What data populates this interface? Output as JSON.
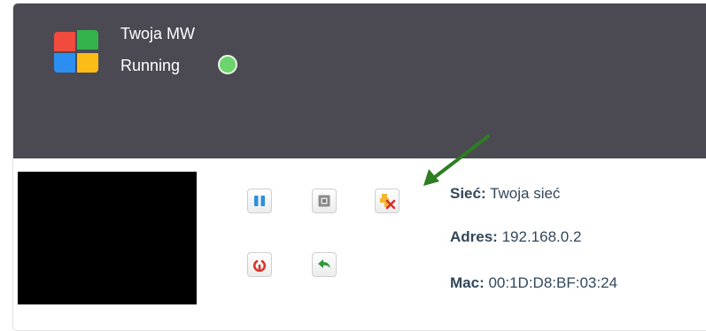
{
  "vm": {
    "name": "Twoja MW",
    "status": "Running",
    "status_color": "#6cd46c",
    "logo_icon": "windows-logo-icon"
  },
  "controls": {
    "pause": "pause-icon",
    "stop": "stop-icon",
    "delete": "delete-vm-icon",
    "restart": "power-icon",
    "revert": "revert-icon"
  },
  "details": {
    "network_label": "Sieć:",
    "network_value": "Twoja sieć",
    "address_label": "Adres:",
    "address_value": "192.168.0.2",
    "mac_label": "Mac:",
    "mac_value": "00:1D:D8:BF:03:24"
  },
  "annotation": {
    "arrow_color": "#2e7d22"
  }
}
